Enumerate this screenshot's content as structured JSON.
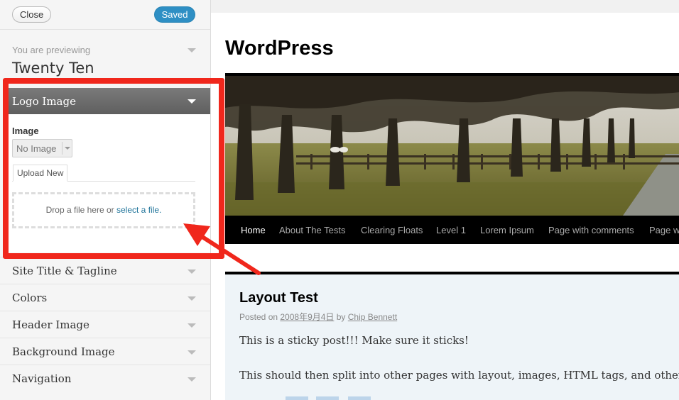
{
  "topbar": {
    "close_label": "Close",
    "saved_label": "Saved"
  },
  "preview_info": {
    "label": "You are previewing",
    "theme": "Twenty Ten"
  },
  "logo_section": {
    "title": "Logo Image",
    "image_label": "Image",
    "select_value": "No Image",
    "upload_tab": "Upload New",
    "drop_text": "Drop a file here or ",
    "drop_link": "select a file."
  },
  "sections": [
    {
      "label": "Site Title & Tagline"
    },
    {
      "label": "Colors"
    },
    {
      "label": "Header Image"
    },
    {
      "label": "Background Image"
    },
    {
      "label": "Navigation"
    }
  ],
  "site": {
    "title": "WordPress",
    "nav": [
      "Home",
      "About The Tests",
      "Clearing Floats",
      "Level 1",
      "Lorem Ipsum",
      "Page with comments",
      "Page w"
    ],
    "post_title": "Layout Test",
    "posted_on": "Posted on ",
    "post_date": "2008年9月4日",
    "by": " by ",
    "author": "Chip Bennett",
    "para1": "This is a sticky post!!! Make sure it sticks!",
    "para2": "This should then split into other pages with layout, images, HTML tags, and other thing"
  },
  "colors": {
    "saved_blue": "#2e8fc4",
    "annotation_red": "#f0271c",
    "link_blue": "#21759b"
  }
}
